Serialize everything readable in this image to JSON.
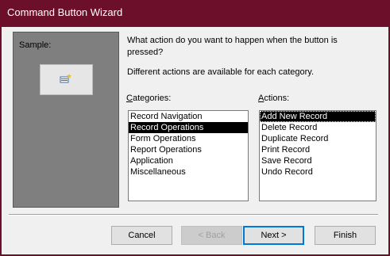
{
  "window": {
    "title": "Command Button Wizard",
    "title_color": "#6b0f2a"
  },
  "sample": {
    "label": "Sample:",
    "icon": "add-new-record-icon"
  },
  "question": "What action do you want to happen when the button is pressed?",
  "description": "Different actions are available for each category.",
  "categories": {
    "label": "Categories:",
    "items": [
      "Record Navigation",
      "Record Operations",
      "Form Operations",
      "Report Operations",
      "Application",
      "Miscellaneous"
    ],
    "selected": "Record Operations"
  },
  "actions": {
    "label": "Actions:",
    "items": [
      "Add New Record",
      "Delete Record",
      "Duplicate Record",
      "Print Record",
      "Save Record",
      "Undo Record"
    ],
    "selected": "Add New Record"
  },
  "buttons": {
    "cancel": "Cancel",
    "back": "< Back",
    "next": "Next >",
    "finish": "Finish"
  }
}
